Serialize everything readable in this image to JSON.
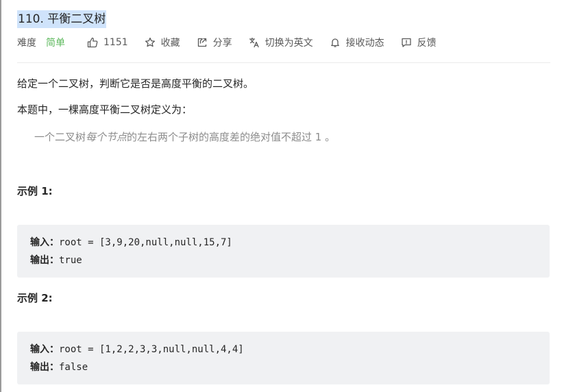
{
  "problem": {
    "title": "110. 平衡二叉树"
  },
  "meta": {
    "difficulty_label": "难度",
    "difficulty": "简单",
    "likes": "1151",
    "favorite": "收藏",
    "share": "分享",
    "switch_lang": "切换为英文",
    "notify": "接收动态",
    "feedback": "反馈",
    "colors": {
      "difficulty_easy": "#5cb85c"
    },
    "icons": [
      "thumbs-up-icon",
      "star-icon",
      "share-icon",
      "translate-icon",
      "bell-icon",
      "feedback-icon"
    ]
  },
  "description": {
    "p1": "给定一个二叉树，判断它是否是高度平衡的二叉树。",
    "p2": "本题中，一棵高度平衡二叉树定义为：",
    "quote_pre": "一个二叉树",
    "quote_em": "每个节点",
    "quote_post": "的左右两个子树的高度差的绝对值不超过 1 。"
  },
  "examples": [
    {
      "heading": "示例 1:",
      "input_label": "输入：",
      "input": "root = [3,9,20,null,null,15,7]",
      "output_label": "输出：",
      "output": "true"
    },
    {
      "heading": "示例 2:",
      "input_label": "输入：",
      "input": "root = [1,2,2,3,3,null,null,4,4]",
      "output_label": "输出：",
      "output": "false"
    }
  ]
}
